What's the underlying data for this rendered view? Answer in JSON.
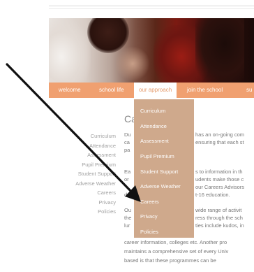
{
  "nav": {
    "items": [
      "welcome",
      "school life",
      "our approach",
      "join the school",
      "su"
    ],
    "active_index": 2
  },
  "dropdown": {
    "items": [
      "Curriculum",
      "Attendance",
      "Assessment",
      "Pupil Premium",
      "Student Support",
      "Adverse Weather",
      "Careers",
      "Privacy",
      "Policies"
    ]
  },
  "subnav": {
    "items": [
      "Curriculum",
      "Attendance",
      "Assessment",
      "Pupil Premium",
      "Student Support",
      "Adverse Weather",
      "Careers",
      "Privacy",
      "Policies"
    ]
  },
  "main": {
    "heading": "Ca",
    "lines": [
      "Du",
      "has an on-going com",
      "ca",
      "ensuring that each st",
      "pa",
      "Ea",
      "s to information in th",
      "or",
      "udents make those c",
      "our Careers Advisors",
      "de",
      "t-16 education.",
      "Ou",
      "wide range of activit",
      "the",
      "ress through the sch",
      "lur",
      "ties include kudos, in",
      "career information, colleges etc. Another pro",
      "maintains a comprehensive set of every Univ",
      "based is that these programmes can be"
    ]
  },
  "colors": {
    "nav_bg": "#f0a070",
    "dropdown_bg": "#cfa98c",
    "active_text": "#e59a6b"
  }
}
